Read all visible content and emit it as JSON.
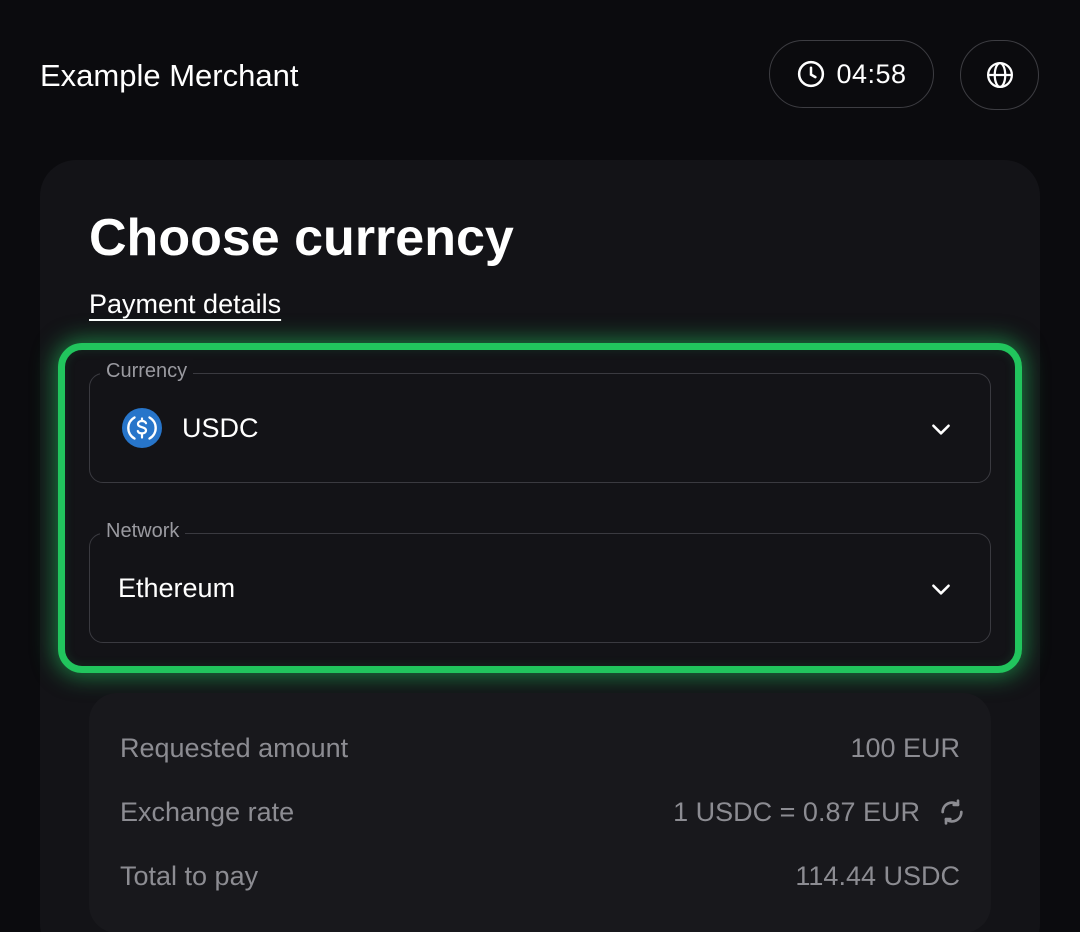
{
  "header": {
    "merchant_name": "Example Merchant",
    "timer": "04:58"
  },
  "card": {
    "title": "Choose currency",
    "details_link": "Payment details"
  },
  "currency_field": {
    "label": "Currency",
    "value": "USDC"
  },
  "network_field": {
    "label": "Network",
    "value": "Ethereum"
  },
  "summary": {
    "requested_amount_label": "Requested amount",
    "requested_amount_value": "100 EUR",
    "exchange_rate_label": "Exchange rate",
    "exchange_rate_value": "1 USDC = 0.87 EUR",
    "total_label": "Total to pay",
    "total_value": "114.44 USDC"
  },
  "colors": {
    "accent_highlight": "#21c55d",
    "usdc_blue": "#2775ca",
    "background": "#0b0b0e",
    "card": "#131317"
  },
  "icons": [
    "clock-icon",
    "globe-icon",
    "usdc-icon",
    "chevron-down-icon",
    "refresh-icon"
  ]
}
